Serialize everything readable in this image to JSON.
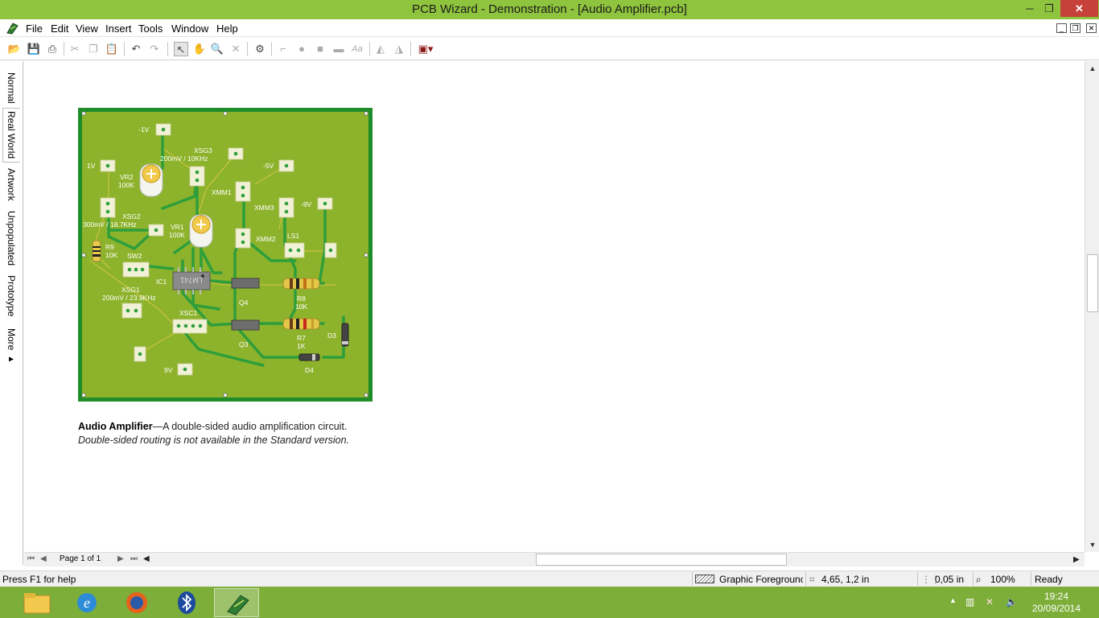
{
  "window": {
    "title": "PCB Wizard - Demonstration - [Audio Amplifier.pcb]",
    "min_glyph": "─",
    "max_glyph": "❐",
    "close_glyph": "✕"
  },
  "menu": {
    "items": [
      "File",
      "Edit",
      "View",
      "Insert",
      "Tools",
      "Window",
      "Help"
    ],
    "mdi": [
      "_",
      "❐",
      "✕"
    ]
  },
  "toolbar": {
    "buttons": [
      {
        "name": "open-icon",
        "glyph": "📂"
      },
      {
        "name": "save-icon",
        "glyph": "💾"
      },
      {
        "name": "print-icon",
        "glyph": "⎙"
      },
      {
        "name": "cut-icon",
        "glyph": "✂"
      },
      {
        "name": "copy-icon",
        "glyph": "❐"
      },
      {
        "name": "paste-icon",
        "glyph": "📋"
      },
      {
        "name": "undo-icon",
        "glyph": "↶"
      },
      {
        "name": "redo-icon",
        "glyph": "↷"
      },
      {
        "name": "select-arrow-icon",
        "glyph": "↖"
      },
      {
        "name": "pan-hand-icon",
        "glyph": "✋"
      },
      {
        "name": "zoom-icon",
        "glyph": "🔍"
      },
      {
        "name": "delete-icon",
        "glyph": "✕"
      },
      {
        "name": "components-icon",
        "glyph": "⚙"
      },
      {
        "name": "track-icon",
        "glyph": "⌐"
      },
      {
        "name": "pad-icon",
        "glyph": "●"
      },
      {
        "name": "square-pad-icon",
        "glyph": "■"
      },
      {
        "name": "copper-area-icon",
        "glyph": "▬"
      },
      {
        "name": "text-icon",
        "glyph": "Aa"
      },
      {
        "name": "mirror-icon",
        "glyph": "◭"
      },
      {
        "name": "flip-icon",
        "glyph": "◮"
      },
      {
        "name": "manufacture-icon",
        "glyph": "▣▾"
      }
    ]
  },
  "side_tabs": [
    "Normal",
    "Real World",
    "Artwork",
    "Unpopulated",
    "Prototype",
    "More ▸"
  ],
  "pcb": {
    "labels": {
      "neg1v": "-1V",
      "xsg3": "XSG3",
      "xsg3_val": "200mV / 10KHz",
      "v1": "1V",
      "vr2": "VR2",
      "vr2_val": "100K",
      "neg5v": "-5V",
      "xmm1": "XMM1",
      "xmm3": "XMM3",
      "neg9v": "-9V",
      "xsg2": "XSG2",
      "xsg2_val": "300mV / 18.7KHz",
      "vr1": "VR1",
      "vr1_val": "100K",
      "xmm2": "XMM2",
      "ls1": "LS1",
      "r9": "R9",
      "r9_val": "10K",
      "sw2": "SW2",
      "ic1": "IC1",
      "ic_chip": "LM741",
      "q4": "Q4",
      "r8": "R8",
      "r8_val": "10K",
      "xsg1": "XSG1",
      "xsg1_val": "200mV / 23.9KHz",
      "xsc1": "XSC1",
      "d3": "D3",
      "r7": "R7",
      "r7_val": "1K",
      "q3": "Q3",
      "d4": "D4",
      "v9": "9V"
    },
    "board_color": "#8db32c",
    "track_color": "#2e9e3a",
    "edge_color": "#1f8c2a"
  },
  "caption": {
    "bold": "Audio Amplifier",
    "rest": "—A double-sided audio amplification circuit.",
    "note": "Double-sided routing is not available in the Standard version."
  },
  "page_nav": {
    "label": "Page 1 of 1"
  },
  "status": {
    "help": "Press F1 for help",
    "layer": "Graphic Foregrounc",
    "coords": "4,65, 1,2 in",
    "grid": "0,05 in",
    "zoom": "100%",
    "state": "Ready"
  },
  "taskbar": {
    "time": "19:24",
    "date": "20/09/2014",
    "accent": "#7eae3a"
  }
}
